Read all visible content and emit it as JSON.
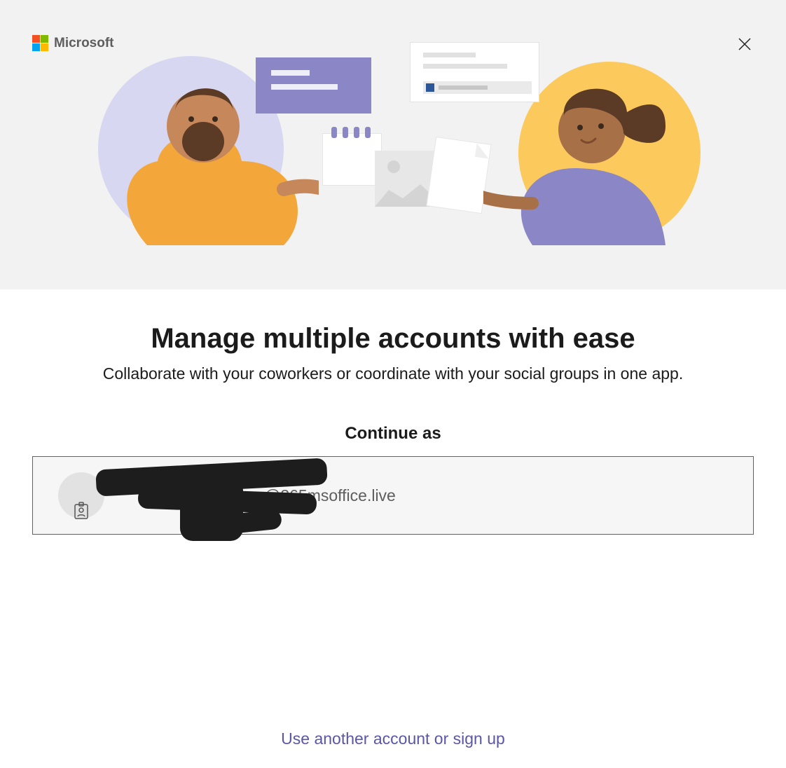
{
  "brand": {
    "name": "Microsoft"
  },
  "main": {
    "title": "Manage multiple accounts with ease",
    "subtitle": "Collaborate with your coworkers or coordinate with your social groups in one app.",
    "continue_label": "Continue as"
  },
  "account": {
    "name_redacted": true,
    "email_visible_suffix": "@365msoffice.live"
  },
  "footer": {
    "alt_action": "Use another account or sign up"
  }
}
